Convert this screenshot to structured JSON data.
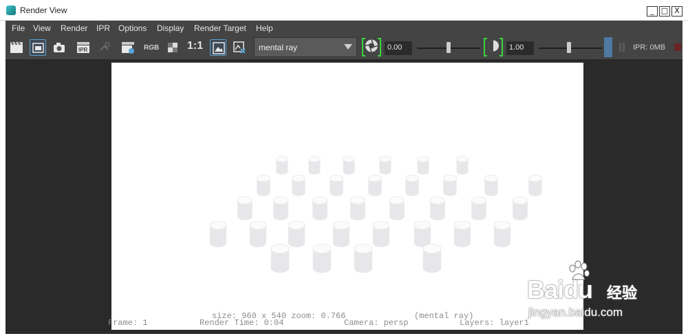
{
  "window": {
    "title": "Render View",
    "controls": [
      "_",
      "□",
      "X"
    ]
  },
  "menu": [
    "File",
    "View",
    "Render",
    "IPR",
    "Options",
    "Display",
    "Render Target",
    "Help"
  ],
  "toolbar": {
    "rgb_label": "RGB",
    "one_to_one_label": "1:1",
    "renderer_value": "mental ray",
    "exposure_value": "0.00",
    "gamma_value": "1.00",
    "ipr_memory": "IPR: 0MB"
  },
  "image_overlay": {
    "size_line": "size: 960 x 540 zoom: 0.766",
    "renderer_tag": "(mental ray)",
    "frame": "Frame: 1",
    "render_time": "Render Time: 0:04",
    "camera": "Camera: persp",
    "layers": "Layers: layer1"
  },
  "watermark": {
    "brand": "Baidu",
    "suffix": "经验",
    "url": "jingyan.baidu.com"
  },
  "colors": {
    "app_bg": "#444444",
    "viewport_bg": "#2a2a2a",
    "accent_green": "#3ed43e",
    "ipr_blue": "#4e7aa3"
  }
}
